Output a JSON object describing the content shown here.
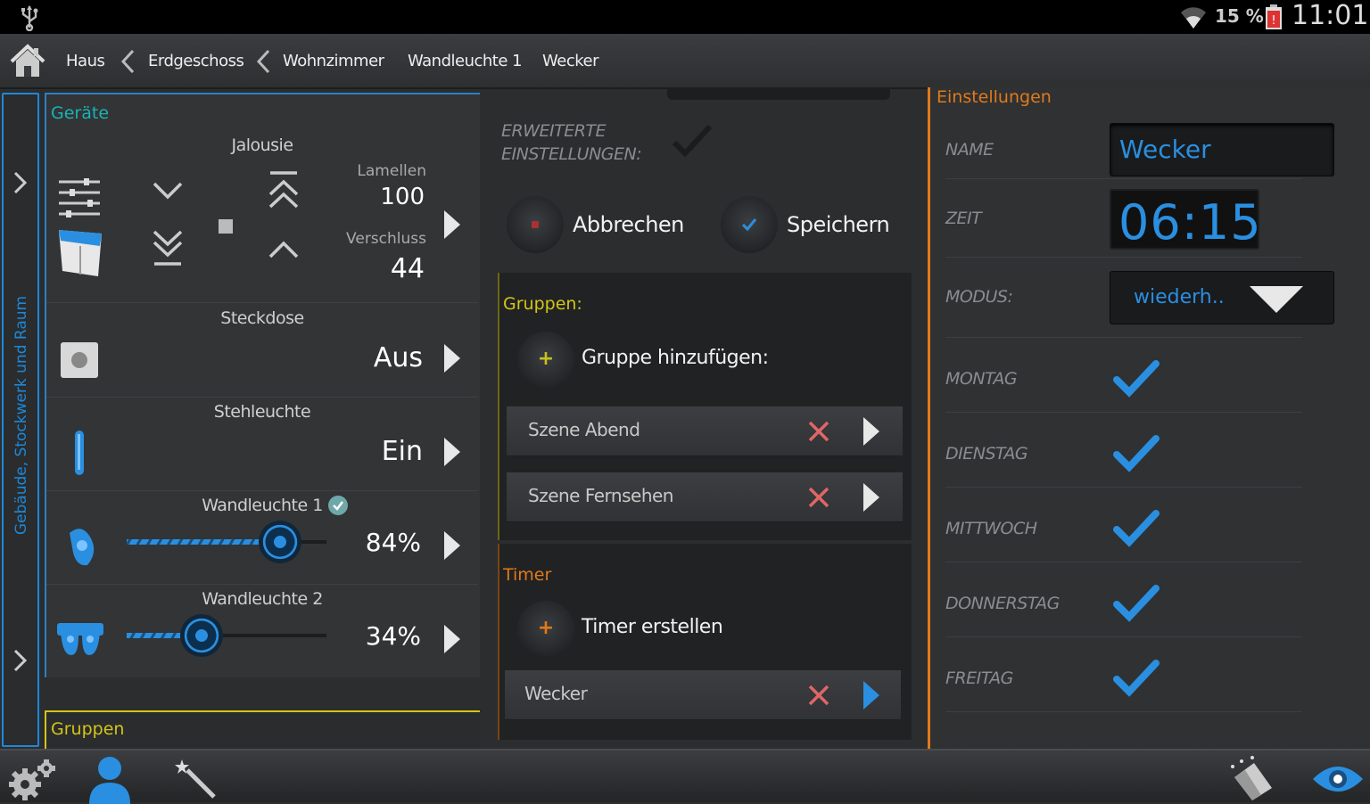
{
  "status": {
    "battery": "15 %",
    "time": "11:01"
  },
  "breadcrumb": [
    "Haus",
    "Erdgeschoss",
    "Wohnzimmer",
    "Wandleuchte 1",
    "Wecker"
  ],
  "sidebar": {
    "label": "Gebäude, Stockwerk und Raum"
  },
  "devices": {
    "header": "Geräte",
    "jalousie": {
      "title": "Jalousie",
      "lamellen_label": "Lamellen",
      "lamellen_value": "100",
      "verschluss_label": "Verschluss",
      "verschluss_value": "44"
    },
    "steckdose": {
      "title": "Steckdose",
      "value": "Aus"
    },
    "stehleuchte": {
      "title": "Stehleuchte",
      "value": "Ein"
    },
    "wandleuchte1": {
      "title": "Wandleuchte 1",
      "value": "84%",
      "level": 0.84
    },
    "wandleuchte2": {
      "title": "Wandleuchte 2",
      "value": "34%",
      "level": 0.34
    }
  },
  "groups_left": {
    "header": "Gruppen"
  },
  "middle": {
    "extended_label_1": "ERWEITERTE",
    "extended_label_2": "EINSTELLUNGEN:",
    "cancel": "Abbrechen",
    "save": "Speichern",
    "groups_header": "Gruppen:",
    "add_group": "Gruppe hinzufügen:",
    "groups": [
      "Szene Abend",
      "Szene Fernsehen"
    ],
    "timer_header": "Timer",
    "create_timer": "Timer erstellen",
    "timers": [
      "Wecker"
    ]
  },
  "settings": {
    "header": "Einstellungen",
    "name_label": "NAME",
    "name_value": "Wecker",
    "time_label": "ZEIT",
    "time_value": "06:15",
    "mode_label": "MODUS:",
    "mode_value": "wiederh..",
    "days": [
      "MONTAG",
      "DIENSTAG",
      "MITTWOCH",
      "DONNERSTAG",
      "FREITAG"
    ]
  },
  "colors": {
    "accent_blue": "#1e88d8",
    "timer_orange": "#e07a1a",
    "group_yellow": "#d4c516",
    "teal": "#19b3b3"
  }
}
